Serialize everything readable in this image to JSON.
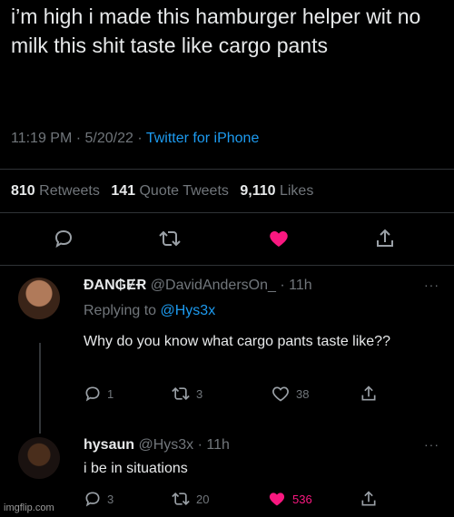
{
  "tweet": {
    "text": "i’m high i made this hamburger helper wit no milk this shit taste like cargo pants",
    "time": "11:19 PM",
    "sep1": " · ",
    "date": "5/20/22",
    "sep2": " · ",
    "source": "Twitter for iPhone",
    "stats": {
      "retweets_count": "810",
      "retweets_label": "Retweets",
      "quotes_count": "141",
      "quotes_label": "Quote Tweets",
      "likes_count": "9,110",
      "likes_label": "Likes"
    }
  },
  "replies": [
    {
      "name": "ĐAN₲ɆɌ",
      "handle": "@DavidAndersOn_",
      "time": "· 11h",
      "replying_prefix": "Replying to ",
      "replying_to": "@Hys3x",
      "text": "Why do you know what cargo pants taste like??",
      "reply_count": "1",
      "retweet_count": "3",
      "like_count": "38",
      "liked": false
    },
    {
      "name": "hysaun",
      "handle": "@Hys3x",
      "time": "· 11h",
      "text": "i be in situations",
      "reply_count": "3",
      "retweet_count": "20",
      "like_count": "536",
      "liked": true
    }
  ],
  "more_label": "···",
  "watermark": "imgflip.com",
  "colors": {
    "accent": "#1d9bf0",
    "like": "#f91880",
    "muted": "#71767b"
  },
  "icons": [
    "reply-icon",
    "retweet-icon",
    "heart-icon",
    "share-icon",
    "more-icon"
  ]
}
